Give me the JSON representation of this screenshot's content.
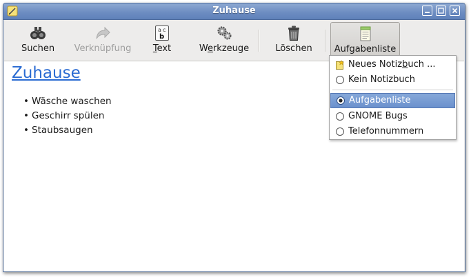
{
  "window": {
    "title": "Zuhause"
  },
  "toolbar": {
    "items": [
      {
        "label": "Suchen",
        "icon": "binoculars-icon",
        "enabled": true,
        "mnemonic": ""
      },
      {
        "label": "Verknüpfung",
        "icon": "link-arrow-icon",
        "enabled": false,
        "mnemonic": ""
      },
      {
        "label": "Text",
        "icon": "text-format-icon",
        "enabled": true,
        "mnemonic": "T"
      },
      {
        "label": "Werkzeuge",
        "icon": "gears-icon",
        "enabled": true,
        "mnemonic": "e"
      },
      {
        "label": "Löschen",
        "icon": "trash-icon",
        "enabled": true,
        "mnemonic": ""
      },
      {
        "label": "Aufgabenliste",
        "icon": "notebook-icon",
        "enabled": true,
        "mnemonic": ""
      }
    ]
  },
  "note": {
    "title": "Zuhause",
    "items": [
      "Wäsche waschen",
      "Geschirr spülen",
      "Staubsaugen"
    ]
  },
  "menu": {
    "items": [
      {
        "label": "Neues Notizbuch ...",
        "icon": "new-notebook-icon",
        "selected": false
      },
      {
        "label": "Kein Notizbuch",
        "icon": "radio-icon",
        "selected": false
      },
      {
        "label": "Aufgabenliste",
        "icon": "radio-checked-icon",
        "selected": true
      },
      {
        "label": "GNOME Bugs",
        "icon": "radio-icon",
        "selected": false
      },
      {
        "label": "Telefonnummern",
        "icon": "radio-icon",
        "selected": false
      }
    ]
  },
  "colors": {
    "titlebar": "#6d8dc2",
    "link": "#2a6bd2",
    "menu_selected": "#7297d0"
  }
}
